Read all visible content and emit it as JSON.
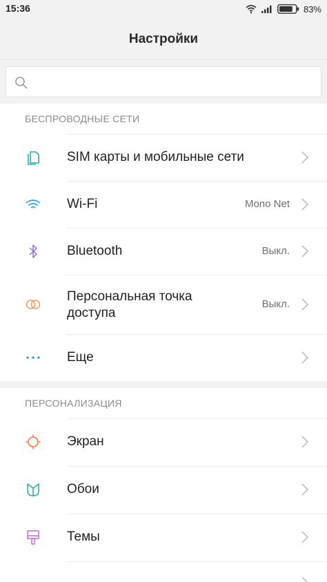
{
  "status_bar": {
    "time": "15:36",
    "battery_percent": "83%",
    "battery_level": 0.83
  },
  "header": {
    "title": "Настройки"
  },
  "search": {
    "placeholder": ""
  },
  "sections": {
    "wireless": {
      "title": "БЕСПРОВОДНЫЕ СЕТИ"
    },
    "personalization": {
      "title": "ПЕРСОНАЛИЗАЦИЯ"
    }
  },
  "items": {
    "sim": {
      "label": "SIM карты и мобильные сети",
      "icon": "sim-card-icon",
      "color": "#21b5a8"
    },
    "wifi": {
      "label": "Wi-Fi",
      "value": "Mono Net",
      "icon": "wifi-icon",
      "color": "#29a7de"
    },
    "bluetooth": {
      "label": "Bluetooth",
      "value": "Выкл.",
      "icon": "bluetooth-icon",
      "color": "#8e6fe3"
    },
    "hotspot": {
      "label_line1": "Персональная точка",
      "label_line2": "доступа",
      "value": "Выкл.",
      "icon": "hotspot-icon",
      "color": "#f39a58"
    },
    "more": {
      "label": "Еще",
      "icon": "more-dots-icon",
      "color": "#2c8fd6"
    },
    "display": {
      "label": "Экран",
      "icon": "brightness-icon",
      "color": "#f0733a"
    },
    "wallpaper": {
      "label": "Обои",
      "icon": "wallpaper-tulip-icon",
      "color": "#1fae9a"
    },
    "themes": {
      "label": "Темы",
      "icon": "themes-brush-icon",
      "color": "#c26be0"
    }
  }
}
